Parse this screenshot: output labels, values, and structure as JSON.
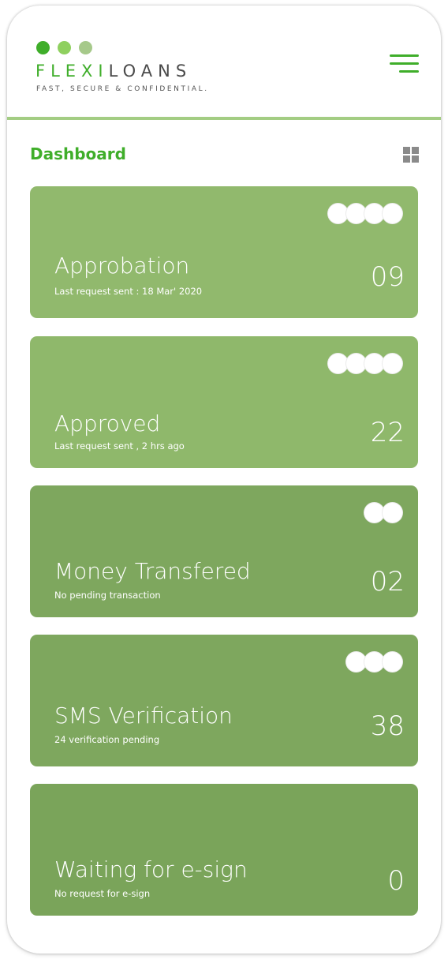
{
  "header": {
    "logo_word_green": "FLEXI",
    "logo_word_dark": "LOANS",
    "logo_tagline": "FAST, SECURE & CONFIDENTIAL.",
    "menu_icon": "hamburger-menu-icon"
  },
  "colors": {
    "brand_green": "#3fae2a",
    "divider": "#a3cd83",
    "card_light": "#91b96d",
    "card_dark": "#7ea75e"
  },
  "dashboard": {
    "title": "Dashboard",
    "view_icon": "grid-view-icon"
  },
  "cards": [
    {
      "title": "Approbation",
      "subtitle": "Last request sent : 18 Mar' 2020",
      "count": "09",
      "avatars": 4
    },
    {
      "title": "Approved",
      "subtitle": "Last request sent , 2 hrs ago",
      "count": "22",
      "avatars": 4
    },
    {
      "title": "Money Transfered",
      "subtitle": "No pending transaction",
      "count": "02",
      "avatars": 2
    },
    {
      "title": "SMS Verification",
      "subtitle": "24 verification pending",
      "count": "38",
      "avatars": 3
    },
    {
      "title": "Waiting for e-sign",
      "subtitle": "No request for e-sign",
      "count": "0",
      "avatars": 0
    }
  ]
}
